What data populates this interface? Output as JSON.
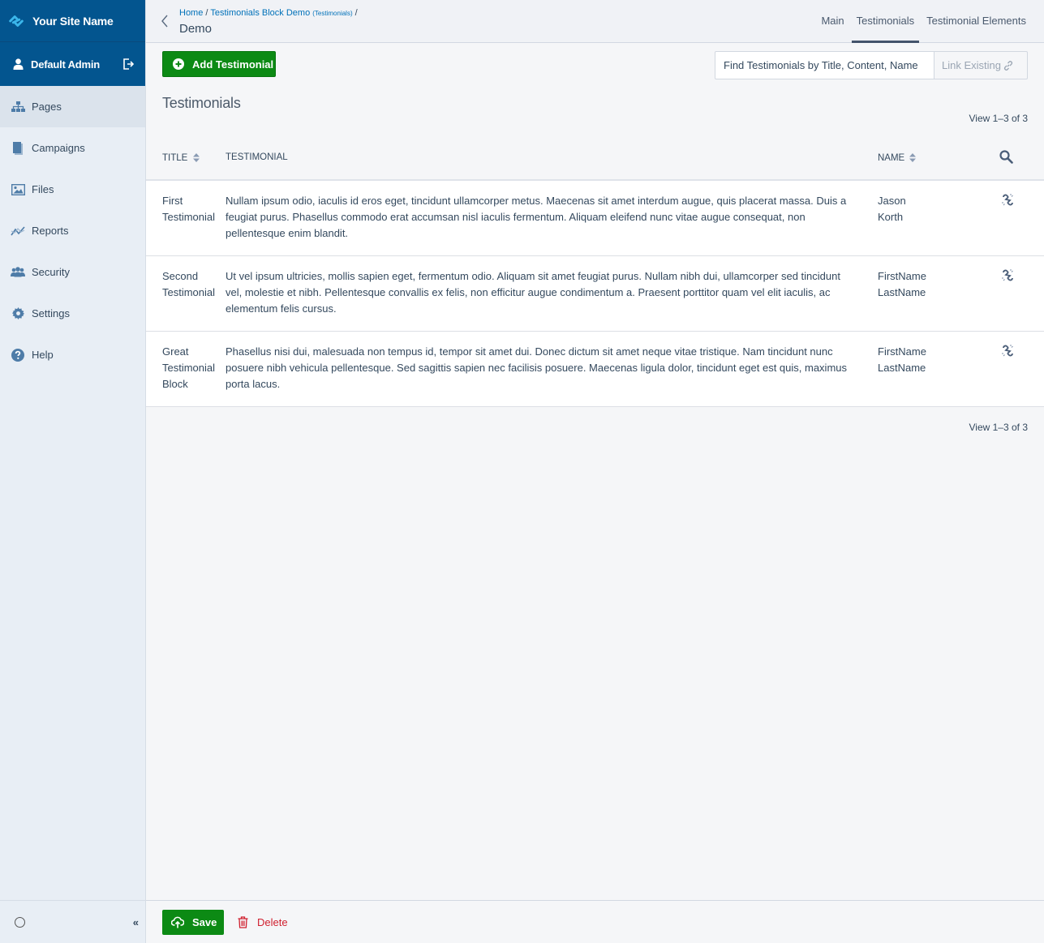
{
  "sidebar": {
    "site_name": "Your Site Name",
    "user_name": "Default Admin",
    "items": [
      {
        "label": "Pages",
        "icon": "sitemap-icon",
        "active": true
      },
      {
        "label": "Campaigns",
        "icon": "campaigns-icon",
        "active": false
      },
      {
        "label": "Files",
        "icon": "image-icon",
        "active": false
      },
      {
        "label": "Reports",
        "icon": "chart-line-icon",
        "active": false
      },
      {
        "label": "Security",
        "icon": "users-icon",
        "active": false
      },
      {
        "label": "Settings",
        "icon": "gear-icon",
        "active": false
      },
      {
        "label": "Help",
        "icon": "question-circle-icon",
        "active": false
      }
    ],
    "collapse_label": "«"
  },
  "header": {
    "breadcrumb": {
      "home": "Home",
      "separator": " / ",
      "parent": "Testimonials Block Demo",
      "parent_type": "(Testimonials)",
      "trailing": " /"
    },
    "title": "Demo",
    "tabs": [
      {
        "label": "Main",
        "active": false
      },
      {
        "label": "Testimonials",
        "active": true
      },
      {
        "label": "Testimonial Elements",
        "active": false
      }
    ]
  },
  "main": {
    "add_button": "Add Testimonial",
    "search_placeholder": "Find Testimonials by Title, Content, Name",
    "link_existing": "Link Existing",
    "section_title": "Testimonials",
    "count_top": "View 1–3 of 3",
    "count_bottom": "View 1–3 of 3",
    "columns": {
      "title": "TITLE",
      "testimonial": "TESTIMONIAL",
      "name": "NAME"
    },
    "rows": [
      {
        "title": "First Testimonial",
        "testimonial": "Nullam ipsum odio, iaculis id eros eget, tincidunt ullamcorper metus. Maecenas sit amet interdum augue, quis placerat massa. Duis a feugiat purus. Phasellus commodo erat accumsan nisl iaculis fermentum. Aliquam eleifend nunc vitae augue consequat, non pellentesque enim blandit.",
        "name_first": "Jason",
        "name_last": "Korth"
      },
      {
        "title": "Second Testimonial",
        "testimonial": "Ut vel ipsum ultricies, mollis sapien eget, fermentum odio. Aliquam sit amet feugiat purus. Nullam nibh dui, ullamcorper sed tincidunt vel, molestie et nibh. Pellentesque convallis ex felis, non efficitur augue condimentum a. Praesent porttitor quam vel elit iaculis, ac elementum felis cursus.",
        "name_first": "FirstName",
        "name_last": "LastName"
      },
      {
        "title": "Great Testimonial Block",
        "testimonial": "Phasellus nisi dui, malesuada non tempus id, tempor sit amet dui. Donec dictum sit amet neque vitae tristique. Nam tincidunt nunc posuere nibh vehicula pellentesque. Sed sagittis sapien nec facilisis posuere. Maecenas ligula dolor, tincidunt eget est quis, maximus porta lacus.",
        "name_first": "FirstName",
        "name_last": "LastName"
      }
    ]
  },
  "footer": {
    "save": "Save",
    "delete": "Delete"
  },
  "colors": {
    "brand": "#03558f",
    "primary_green": "#0c8a14",
    "danger": "#d0202f",
    "link": "#0071b9"
  }
}
